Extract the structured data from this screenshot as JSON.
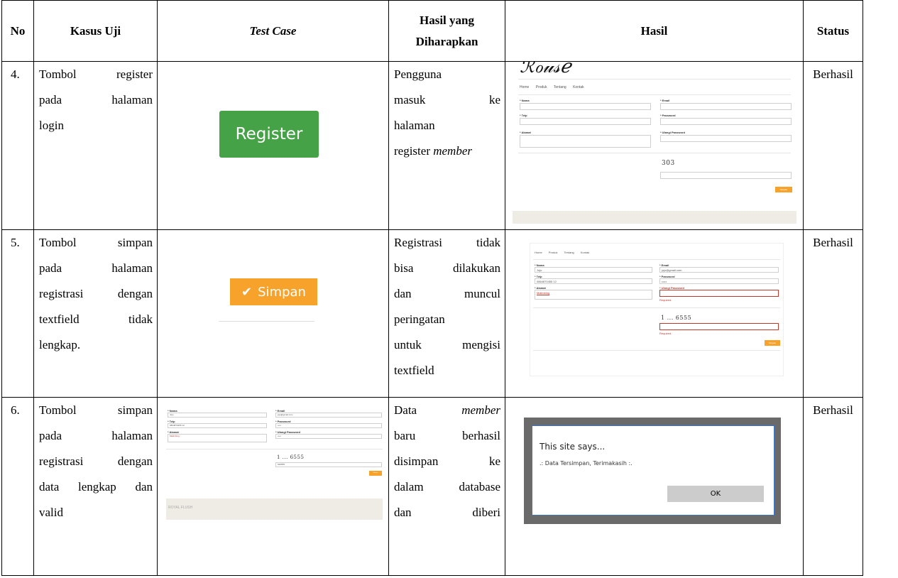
{
  "headers": {
    "no": "No",
    "kasus": "Kasus Uji",
    "test_case": "Test Case",
    "hasil_harapan_1": "Hasil yang",
    "hasil_harapan_2": "Diharapkan",
    "hasil": "Hasil",
    "status": "Status"
  },
  "rows": [
    {
      "no": "4.",
      "kasus": [
        "Tombol register",
        "pada halaman",
        "login"
      ],
      "button_label": "Register",
      "harapan": [
        "Pengguna",
        "masuk ke",
        "halaman",
        "register"
      ],
      "harapan_em": "member",
      "status": "Berhasil"
    },
    {
      "no": "5.",
      "kasus": [
        "Tombol simpan",
        "pada halaman",
        "registrasi dengan",
        "textfield tidak",
        "lengkap."
      ],
      "button_label": "Simpan",
      "harapan": [
        "Registrasi tidak",
        "bisa dilakukan",
        "dan muncul",
        "peringatan",
        "untuk mengisi",
        "textfield"
      ],
      "status": "Berhasil"
    },
    {
      "no": "6.",
      "kasus": [
        "Tombol simpan",
        "pada halaman",
        "registrasi dengan",
        "data lengkap dan",
        "valid"
      ],
      "harapan_1a": "Data",
      "harapan_1b": "member",
      "harapan": [
        "baru berhasil",
        "disimpan ke",
        "dalam database",
        "dan diberi"
      ],
      "status": "Berhasil"
    }
  ],
  "mini_form": {
    "nav": [
      "Home",
      "Produk",
      "Tentang",
      "Kontak"
    ],
    "nama": "* Nama",
    "telp": "* Telp",
    "alamat": "* Alamat",
    "email": "* Email",
    "password": "* Password",
    "ulangi": "* Ulangi Password",
    "captcha_1": "303",
    "captcha_2": "1 ... 6555",
    "nama_val": "Jojo",
    "email_val": "jojo@gmail.com",
    "telp_val": "0864870455 12",
    "pw_val": "•••••",
    "alamat_val": "Malimbing",
    "captcha_input": "626555",
    "required": "Required.",
    "simpan_mini": "Simpan",
    "footer": "ROYAL FLUSH"
  },
  "dialog": {
    "title": "This site says...",
    "message": ".: Data Tersimpan, Terimakasih :.",
    "ok": "OK"
  }
}
